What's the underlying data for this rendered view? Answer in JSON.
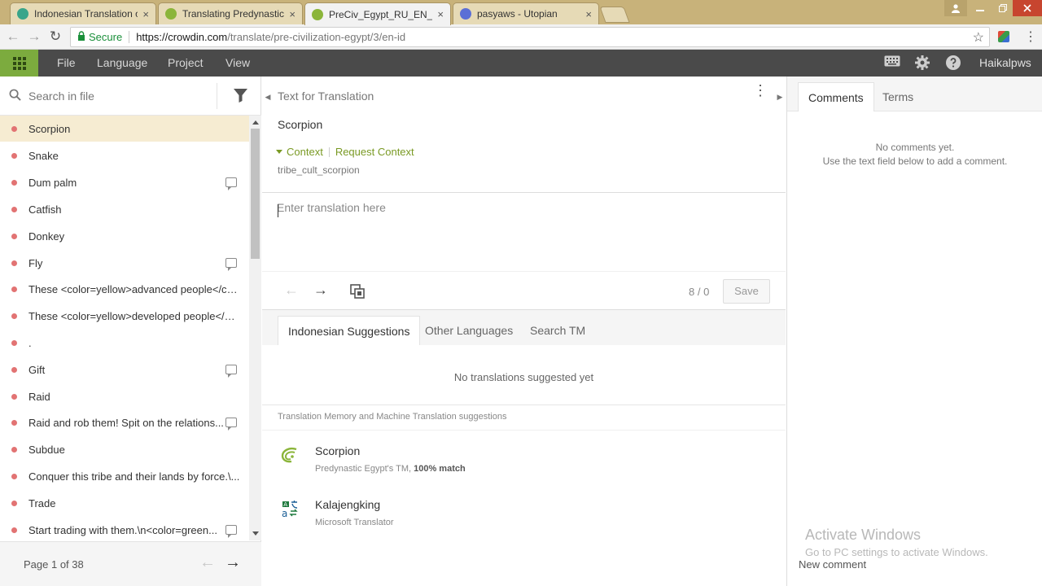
{
  "browser": {
    "tabs": [
      {
        "title": "Indonesian Translation o",
        "favicon_color": "#3aa58a",
        "active": false
      },
      {
        "title": "Translating Predynastic E",
        "favicon_color": "#8bb53a",
        "active": false
      },
      {
        "title": "PreCiv_Egypt_RU_EN_tex",
        "favicon_color": "#8bb53a",
        "active": true
      },
      {
        "title": "pasyaws - Utopian",
        "favicon_color": "#5b6fd6",
        "active": false
      }
    ],
    "tab_close": "×",
    "secure_label": "Secure",
    "url_host": "https://crowdin.com",
    "url_path": "/translate/pre-civilization-egypt/3/en-id"
  },
  "header": {
    "menu": [
      "File",
      "Language",
      "Project",
      "View"
    ],
    "username": "Haikalpws"
  },
  "sidebar": {
    "search_placeholder": "Search in file",
    "items": [
      {
        "label": "Scorpion",
        "comment": false,
        "selected": true
      },
      {
        "label": "Snake",
        "comment": false
      },
      {
        "label": "Dum palm",
        "comment": true
      },
      {
        "label": "Catfish",
        "comment": false
      },
      {
        "label": "Donkey",
        "comment": false
      },
      {
        "label": "Fly",
        "comment": true
      },
      {
        "label": "These <color=yellow>advanced people</col...",
        "comment": false
      },
      {
        "label": "These <color=yellow>developed people</co...",
        "comment": false
      },
      {
        "label": ".",
        "comment": false
      },
      {
        "label": "Gift",
        "comment": true
      },
      {
        "label": "Raid",
        "comment": false
      },
      {
        "label": "Raid and rob them! Spit on the relations...",
        "comment": true
      },
      {
        "label": "Subdue",
        "comment": false
      },
      {
        "label": "Conquer this tribe and their lands by force.\\...",
        "comment": false
      },
      {
        "label": "Trade",
        "comment": false
      },
      {
        "label": "Start trading with them.\\n<color=green...",
        "comment": true
      }
    ],
    "pager": "Page 1 of 38"
  },
  "editor": {
    "source_header": "Text for Translation",
    "source_text": "Scorpion",
    "context_label": "Context",
    "request_context": "Request Context",
    "context_key": "tribe_cult_scorpion",
    "translation_placeholder": "Enter translation here",
    "count": "8 / 0",
    "save_label": "Save",
    "suggestion_tabs": [
      "Indonesian Suggestions",
      "Other Languages",
      "Search TM"
    ],
    "no_suggestions": "No translations suggested yet",
    "tm_label": "Translation Memory and Machine Translation suggestions",
    "suggestions": [
      {
        "text": "Scorpion",
        "source": "Predynastic Egypt's TM, ",
        "match": "100% match"
      },
      {
        "text": "Kalajengking",
        "source": "Microsoft Translator",
        "match": ""
      }
    ]
  },
  "right_panel": {
    "tabs": [
      "Comments",
      "Terms"
    ],
    "no_comments_line1": "No comments yet.",
    "no_comments_line2": "Use the text field below to add a comment.",
    "activate_title": "Activate Windows",
    "activate_sub": "Go to PC settings to activate Windows.",
    "new_comment": "New comment"
  },
  "colors": {
    "accent_green": "#7cab3e",
    "header_dark": "#4a4a4a",
    "untranslated_dot": "#e27373",
    "selected_row": "#f6ecd2",
    "context_link": "#7a9a24"
  }
}
